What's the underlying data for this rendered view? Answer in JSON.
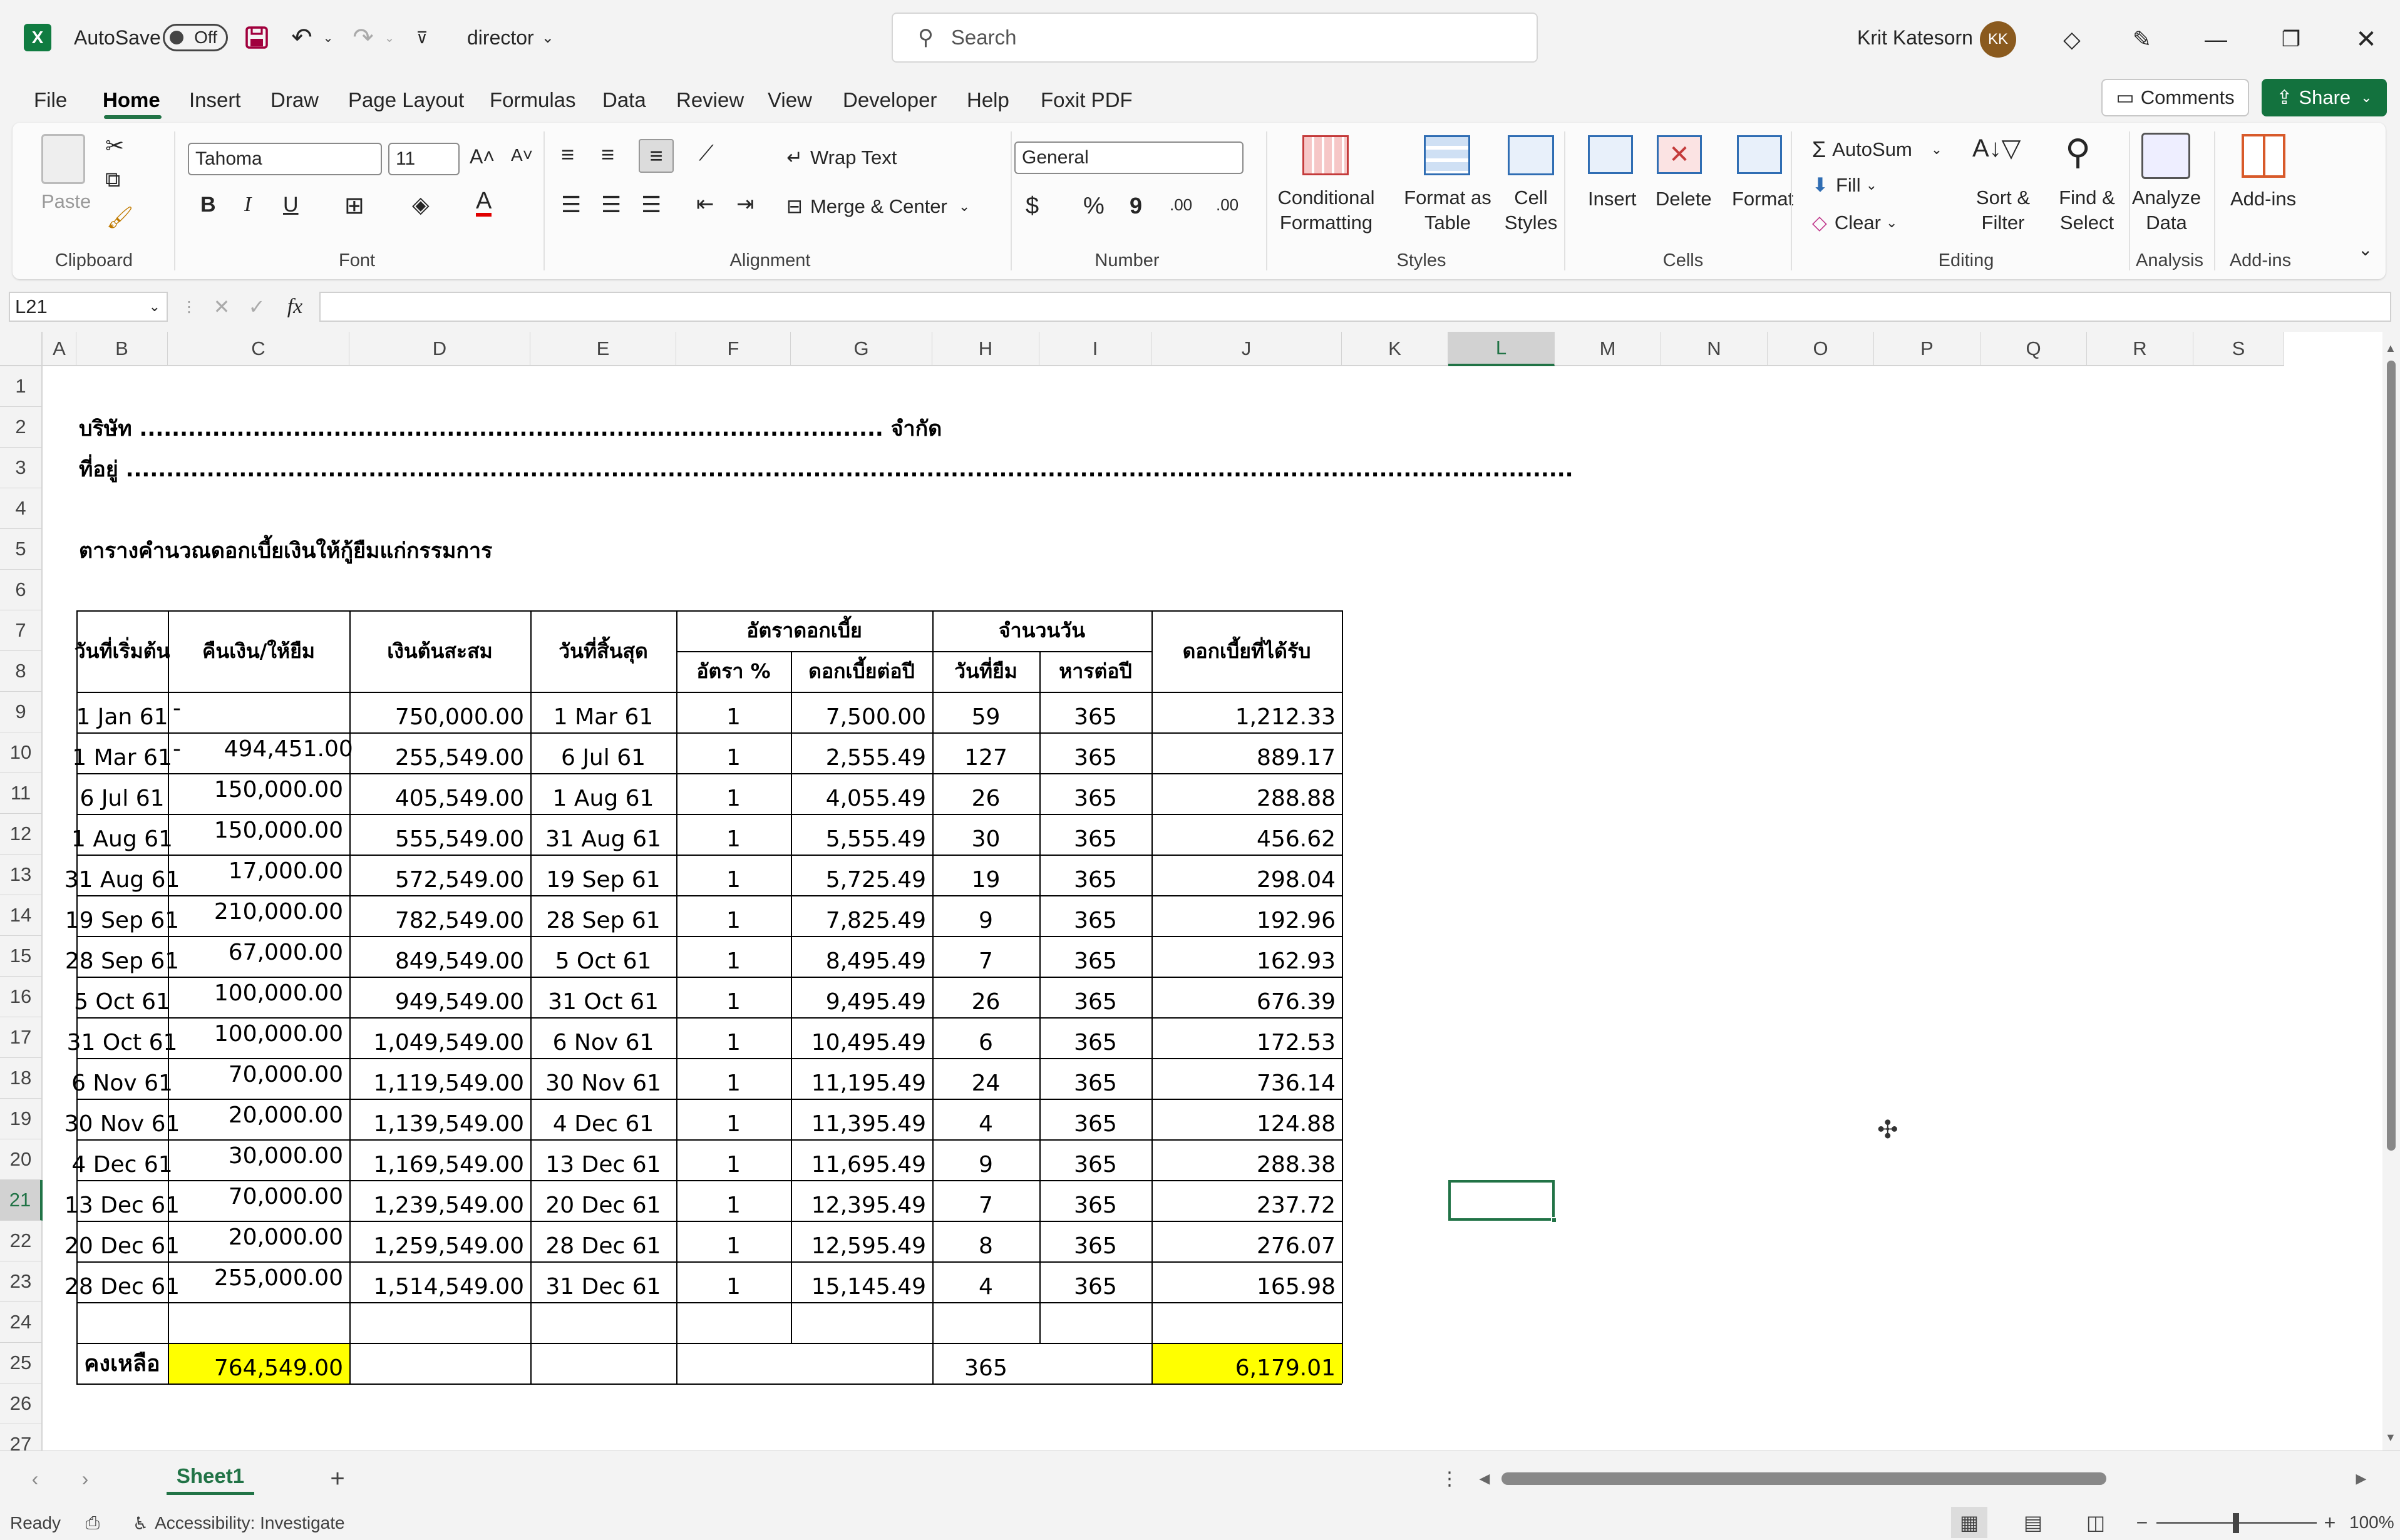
{
  "titlebar": {
    "autosave_label": "AutoSave",
    "autosave_state": "Off",
    "filename": "director",
    "search_placeholder": "Search",
    "user_name": "Krit Katesorn",
    "user_initials": "KK"
  },
  "menu_tabs": [
    "File",
    "Home",
    "Insert",
    "Draw",
    "Page Layout",
    "Formulas",
    "Data",
    "Review",
    "View",
    "Developer",
    "Help",
    "Foxit PDF"
  ],
  "active_tab": "Home",
  "comments_label": "Comments",
  "share_label": "Share",
  "ribbon": {
    "clipboard": {
      "paste": "Paste",
      "group": "Clipboard"
    },
    "font": {
      "name": "Tahoma",
      "size": "11",
      "bold": "B",
      "italic": "I",
      "underline": "U",
      "group": "Font"
    },
    "alignment": {
      "wrap": "Wrap Text",
      "merge": "Merge & Center",
      "group": "Alignment"
    },
    "number": {
      "format": "General",
      "currency": "$",
      "percent": "%",
      "comma": "9",
      "inc": ".00",
      "dec": ".00",
      "group": "Number"
    },
    "styles": {
      "conditional": "Conditional",
      "conditional2": "Formatting",
      "table": "Format as",
      "table2": "Table",
      "cell": "Cell",
      "cell2": "Styles",
      "group": "Styles"
    },
    "cells": {
      "insert": "Insert",
      "delete": "Delete",
      "format": "Format",
      "group": "Cells"
    },
    "editing": {
      "autosum": "AutoSum",
      "fill": "Fill",
      "clear": "Clear",
      "sort": "Sort &",
      "sort2": "Filter",
      "find": "Find &",
      "find2": "Select",
      "group": "Editing"
    },
    "analysis": {
      "analyze": "Analyze",
      "analyze2": "Data",
      "group": "Analysis"
    },
    "addins": {
      "label": "Add-ins",
      "group": "Add-ins"
    }
  },
  "namebox": "L21",
  "columns": [
    "A",
    "B",
    "C",
    "D",
    "E",
    "F",
    "G",
    "H",
    "I",
    "J",
    "K",
    "L",
    "M",
    "N",
    "O",
    "P",
    "Q",
    "R",
    "S"
  ],
  "rows": [
    "1",
    "2",
    "3",
    "4",
    "5",
    "6",
    "7",
    "8",
    "9",
    "10",
    "11",
    "12",
    "13",
    "14",
    "15",
    "16",
    "17",
    "18",
    "19",
    "20",
    "21",
    "22",
    "23",
    "24",
    "25",
    "26",
    "27"
  ],
  "sheet": {
    "company_line": "บริษัท ............................................................................................ จำกัด",
    "address_line": "ที่อยู่ ...................................................................................................................................................................................",
    "table_title": "ตารางคำนวณดอกเบี้ยเงินให้กู้ยืมแก่กรรมการ",
    "headers": {
      "start_date": "วันที่เริ่มต้น",
      "repay_lend": "คืนเงิน/ให้ยืม",
      "principal": "เงินต้นสะสม",
      "end_date": "วันที่สิ้นสุด",
      "rate_group": "อัตราดอกเบี้ย",
      "rate_pct": "อัตรา %",
      "interest_year": "ดอกเบี้ยต่อปี",
      "days_group": "จำนวนวัน",
      "days_borrow": "วันที่ยืม",
      "days_year": "หารต่อปี",
      "interest_received": "ดอกเบี้ยที่ได้รับ"
    },
    "data_rows": [
      [
        "1 Jan 61",
        "-",
        "750,000.00",
        "1 Mar 61",
        "1",
        "7,500.00",
        "59",
        "365",
        "1,212.33"
      ],
      [
        "1 Mar 61",
        "-      494,451.00",
        "255,549.00",
        "6 Jul 61",
        "1",
        "2,555.49",
        "127",
        "365",
        "889.17"
      ],
      [
        "6 Jul 61",
        "150,000.00",
        "405,549.00",
        "1 Aug 61",
        "1",
        "4,055.49",
        "26",
        "365",
        "288.88"
      ],
      [
        "1 Aug 61",
        "150,000.00",
        "555,549.00",
        "31 Aug 61",
        "1",
        "5,555.49",
        "30",
        "365",
        "456.62"
      ],
      [
        "31 Aug 61",
        "17,000.00",
        "572,549.00",
        "19 Sep 61",
        "1",
        "5,725.49",
        "19",
        "365",
        "298.04"
      ],
      [
        "19 Sep 61",
        "210,000.00",
        "782,549.00",
        "28 Sep 61",
        "1",
        "7,825.49",
        "9",
        "365",
        "192.96"
      ],
      [
        "28 Sep 61",
        "67,000.00",
        "849,549.00",
        "5 Oct 61",
        "1",
        "8,495.49",
        "7",
        "365",
        "162.93"
      ],
      [
        "5 Oct 61",
        "100,000.00",
        "949,549.00",
        "31 Oct 61",
        "1",
        "9,495.49",
        "26",
        "365",
        "676.39"
      ],
      [
        "31 Oct 61",
        "100,000.00",
        "1,049,549.00",
        "6 Nov 61",
        "1",
        "10,495.49",
        "6",
        "365",
        "172.53"
      ],
      [
        "6 Nov 61",
        "70,000.00",
        "1,119,549.00",
        "30 Nov 61",
        "1",
        "11,195.49",
        "24",
        "365",
        "736.14"
      ],
      [
        "30 Nov 61",
        "20,000.00",
        "1,139,549.00",
        "4 Dec 61",
        "1",
        "11,395.49",
        "4",
        "365",
        "124.88"
      ],
      [
        "4 Dec 61",
        "30,000.00",
        "1,169,549.00",
        "13 Dec 61",
        "1",
        "11,695.49",
        "9",
        "365",
        "288.38"
      ],
      [
        "13 Dec 61",
        "70,000.00",
        "1,239,549.00",
        "20 Dec 61",
        "1",
        "12,395.49",
        "7",
        "365",
        "237.72"
      ],
      [
        "20 Dec 61",
        "20,000.00",
        "1,259,549.00",
        "28 Dec 61",
        "1",
        "12,595.49",
        "8",
        "365",
        "276.07"
      ],
      [
        "28 Dec 61",
        "255,000.00",
        "1,514,549.00",
        "31 Dec 61",
        "1",
        "15,145.49",
        "4",
        "365",
        "165.98"
      ]
    ],
    "total_label": "คงเหลือ",
    "total_balance": "764,549.00",
    "total_days": "365",
    "total_interest": "6,179.01",
    "highlight_color": "#ffff00"
  },
  "sheet_tab": "Sheet1",
  "status": {
    "ready": "Ready",
    "accessibility": "Accessibility: Investigate",
    "zoom": "100%"
  },
  "colors": {
    "excel_green": "#107c41",
    "accent": "#217346",
    "share_green": "#13723e"
  }
}
